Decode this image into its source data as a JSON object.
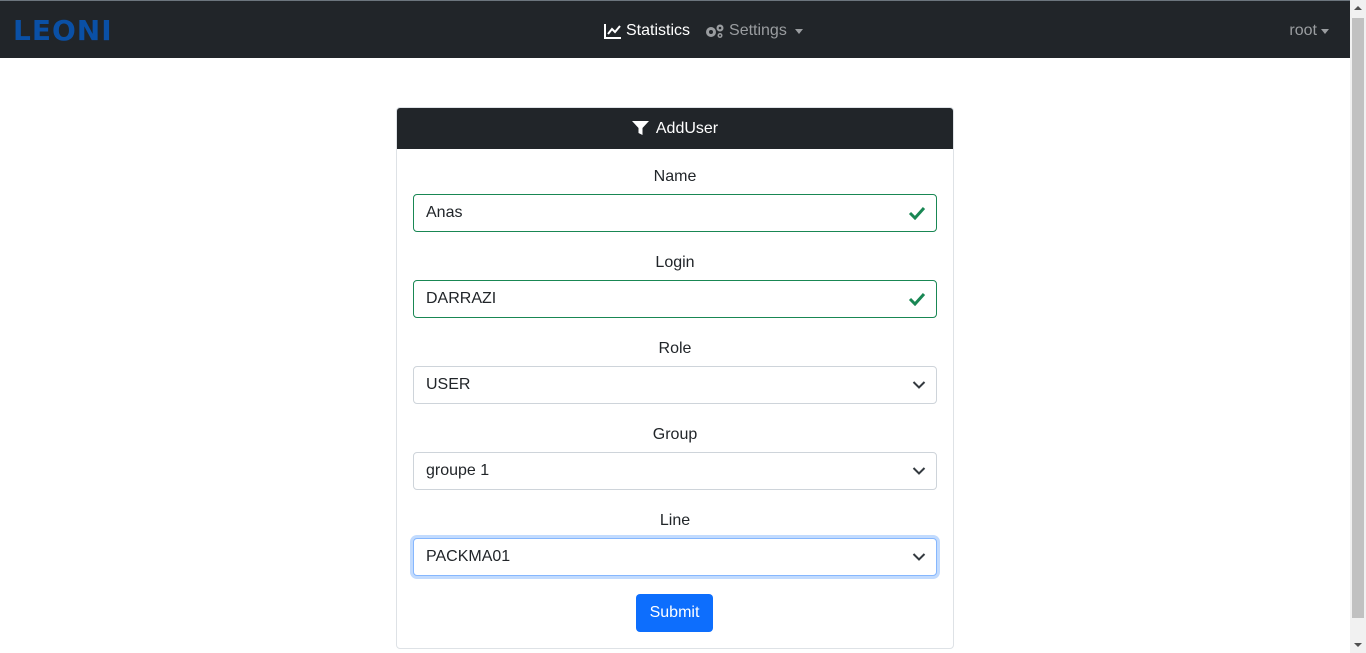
{
  "navbar": {
    "brand": "LEONI",
    "statistics_label": "Statistics",
    "settings_label": "Settings",
    "user_label": "root"
  },
  "card": {
    "title": "AddUser",
    "fields": {
      "name": {
        "label": "Name",
        "value": "Anas"
      },
      "login": {
        "label": "Login",
        "value": "DARRAZI"
      },
      "role": {
        "label": "Role",
        "value": "USER"
      },
      "group": {
        "label": "Group",
        "value": "groupe 1"
      },
      "line": {
        "label": "Line",
        "value": "PACKMA01"
      }
    },
    "submit_label": "Submit"
  },
  "colors": {
    "navbar_bg": "#212529",
    "brand": "#0a50a6",
    "valid": "#198754",
    "primary": "#0d6efd"
  },
  "icons": {
    "statistics": "chart-line-icon",
    "settings": "gears-icon",
    "card_header": "filter-icon",
    "valid": "check-icon",
    "select": "chevron-down-icon"
  }
}
